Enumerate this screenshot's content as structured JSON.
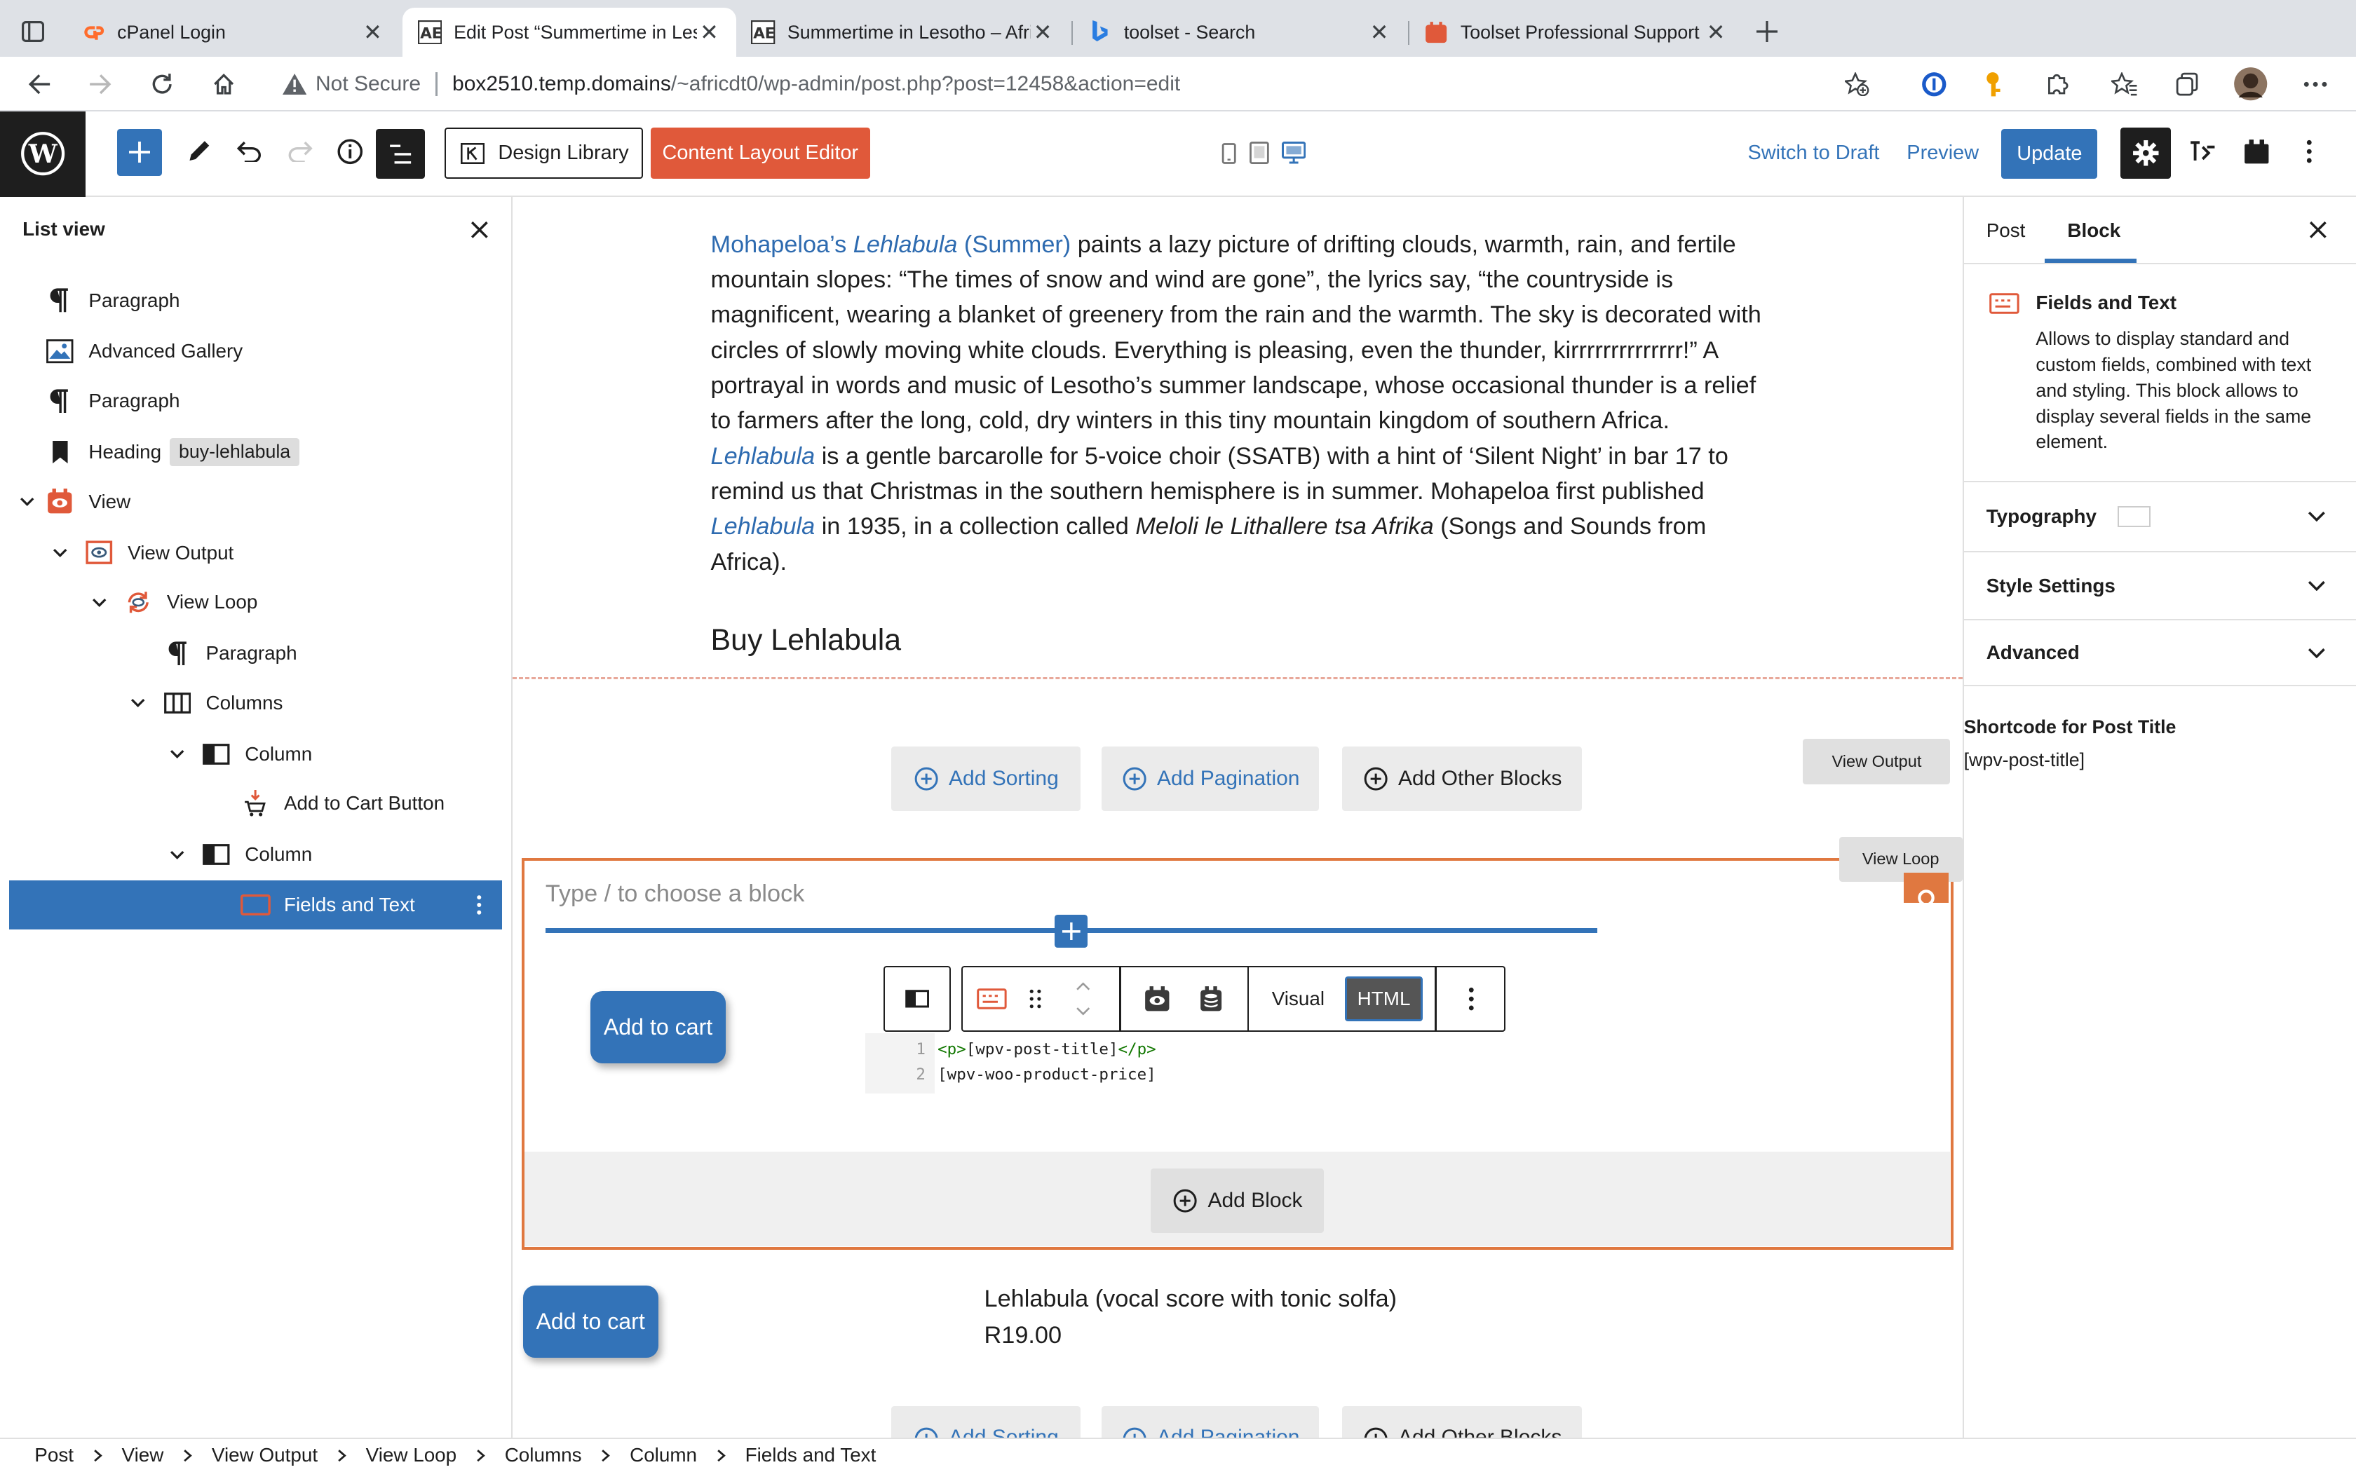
{
  "browser": {
    "tabs": [
      {
        "title": "cPanel Login",
        "favicon": "cpanel-icon"
      },
      {
        "title": "Edit Post “Summertime in Lesotho",
        "favicon": "africa-logo-icon"
      },
      {
        "title": "Summertime in Lesotho – Africa",
        "favicon": "africa-logo-icon"
      },
      {
        "title": "toolset - Search",
        "favicon": "bing-icon"
      },
      {
        "title": "Toolset Professional Support - ",
        "favicon": "toolset-icon"
      }
    ],
    "active_tab": 1,
    "security_label": "Not Secure",
    "url_domain": "box2510.temp.domains",
    "url_path": "/~africdt0/wp-admin/post.php?post=12458&action=edit"
  },
  "wp_header": {
    "design_library": "Design Library",
    "content_layout_editor": "Content Layout Editor",
    "switch_to_draft": "Switch to Draft",
    "preview": "Preview",
    "update": "Update",
    "accent": "#3373b8",
    "orange": "#e0593a"
  },
  "list_view": {
    "title": "List view",
    "items": [
      {
        "label": "Paragraph",
        "icon": "paragraph-icon"
      },
      {
        "label": "Advanced Gallery",
        "icon": "gallery-icon"
      },
      {
        "label": "Paragraph",
        "icon": "paragraph-icon"
      },
      {
        "label": "Heading",
        "icon": "bookmark-icon",
        "badge": "buy-lehlabula"
      },
      {
        "label": "View",
        "icon": "view-icon"
      },
      {
        "label": "View Output",
        "icon": "view-output-icon"
      },
      {
        "label": "View Loop",
        "icon": "view-loop-icon"
      },
      {
        "label": "Paragraph",
        "icon": "paragraph-icon"
      },
      {
        "label": "Columns",
        "icon": "columns-icon"
      },
      {
        "label": "Column",
        "icon": "column-icon"
      },
      {
        "label": "Add to Cart Button",
        "icon": "cart-icon"
      },
      {
        "label": "Column",
        "icon": "column-icon"
      },
      {
        "label": "Fields and Text",
        "icon": "fields-text-icon",
        "selected": true
      }
    ]
  },
  "canvas": {
    "p1_link": "Mohapeloa’s",
    "p1_link_em": "Lehlabula",
    "p1_link_tail": "(Summer)",
    "p1_text1": " paints a lazy picture of drifting clouds, warmth, rain, and fertile mountain slopes: “The times of snow and wind are gone”, the lyrics say, “the countryside is magnificent, wearing a blanket of greenery from the rain and the warmth. The sky is decorated with circles of slowly moving white clouds. Everything is pleasing, even the thunder, kirrrrrrrrrrrrrr!” A portrayal in words and music of Lesotho’s summer landscape, whose occasional thunder is a relief to farmers after the long, cold, dry winters in this tiny mountain kingdom of southern Africa. ",
    "p1_link2": "Lehlabula",
    "p1_text2": " is a gentle barcarolle for 5-voice choir (SSATB) with a hint of ‘Silent Night’ in bar 17 to remind us that Christmas in the southern hemisphere is in summer. Mohapeloa first published ",
    "p1_link3": "Lehlabula",
    "p1_text3": " in 1935, in a collection called ",
    "p1_em": "Meloli le Lithallere tsa Afrika",
    "p1_text4": " (Songs and Sounds from Africa).",
    "heading": "Buy Lehlabula",
    "add_sorting": "Add Sorting",
    "add_pagination": "Add Pagination",
    "add_other_blocks": "Add Other Blocks",
    "view_output_tag": "View Output",
    "view_loop_tag": "View Loop",
    "placeholder": "Type / to choose a block",
    "add_to_cart": "Add to cart",
    "toolbar_visual": "Visual",
    "toolbar_html": "HTML",
    "code_lines": [
      {
        "num": "1",
        "open": "<p>",
        "text": "[wpv-post-title]",
        "close": "</p>"
      },
      {
        "num": "2",
        "open": "",
        "text": "[wpv-woo-product-price]",
        "close": ""
      }
    ],
    "add_block": "Add Block",
    "product_title": "Lehlabula (vocal score with tonic solfa)",
    "product_price": "R19.00"
  },
  "sidebar": {
    "tab_post": "Post",
    "tab_block": "Block",
    "block_title": "Fields and Text",
    "block_desc": "Allows to display standard and custom fields, combined with text and styling. This block allows to display several fields in the same element.",
    "typography": "Typography",
    "style_settings": "Style Settings",
    "advanced": "Advanced",
    "shortcode_label": "Shortcode for Post Title",
    "shortcode_value": "[wpv-post-title]"
  },
  "breadcrumbs": [
    "Post",
    "View",
    "View Output",
    "View Loop",
    "Columns",
    "Column",
    "Fields and Text"
  ]
}
